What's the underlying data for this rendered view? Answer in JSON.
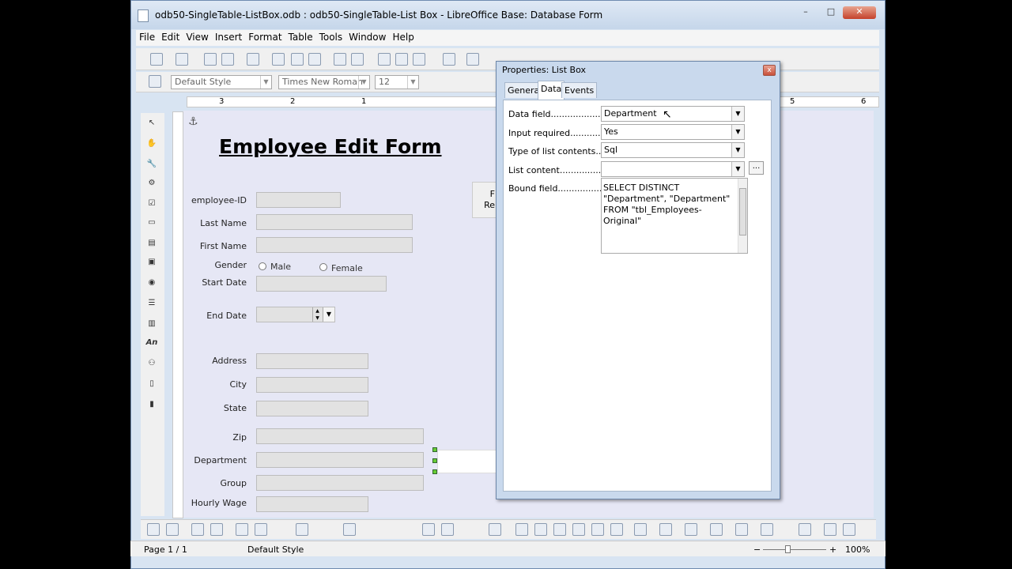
{
  "window": {
    "title": "odb50-SingleTable-ListBox.odb : odb50-SingleTable-List Box - LibreOffice Base: Database Form",
    "min": "–",
    "max": "□",
    "close": "✕"
  },
  "menu": [
    "File",
    "Edit",
    "View",
    "Insert",
    "Format",
    "Table",
    "Tools",
    "Window",
    "Help"
  ],
  "format_bar": {
    "style": "Default Style",
    "font": "Times New Roman",
    "size": "12"
  },
  "ruler_marks": [
    "3",
    "2",
    "1",
    "5",
    "6"
  ],
  "form": {
    "heading": "Employee Edit Form",
    "labels": {
      "employee_id": "employee-ID",
      "last_name": "Last Name",
      "first_name": "First Name",
      "gender": "Gender",
      "male": "Male",
      "female": "Female",
      "start_date": "Start Date",
      "end_date": "End Date",
      "address": "Address",
      "city": "City",
      "state": "State",
      "zip": "Zip",
      "department": "Department",
      "group": "Group",
      "hourly_wage": "Hourly Wage"
    },
    "partial_button": [
      "F",
      "Re"
    ]
  },
  "left_toolbar_text": {
    "an": "An"
  },
  "dialog": {
    "title": "Properties: List Box",
    "close": "x",
    "tabs": [
      "General",
      "Data",
      "Events"
    ],
    "active_tab": "Data",
    "rows": [
      {
        "label": "Data field.......................",
        "value": "Department"
      },
      {
        "label": "Input required...................",
        "value": "Yes"
      },
      {
        "label": "Type of list contents.....",
        "value": "Sql"
      },
      {
        "label": "List content.....................",
        "value": ""
      },
      {
        "label": "Bound field.......................",
        "value": ""
      }
    ],
    "ellipsis": "...",
    "sql": "SELECT DISTINCT \"Department\", \"Department\" FROM \"tbl_Employees-Original\""
  },
  "status": {
    "page": "Page 1 / 1",
    "style": "Default Style",
    "zoom": "100%",
    "zoom_minus": "−",
    "zoom_plus": "+"
  }
}
